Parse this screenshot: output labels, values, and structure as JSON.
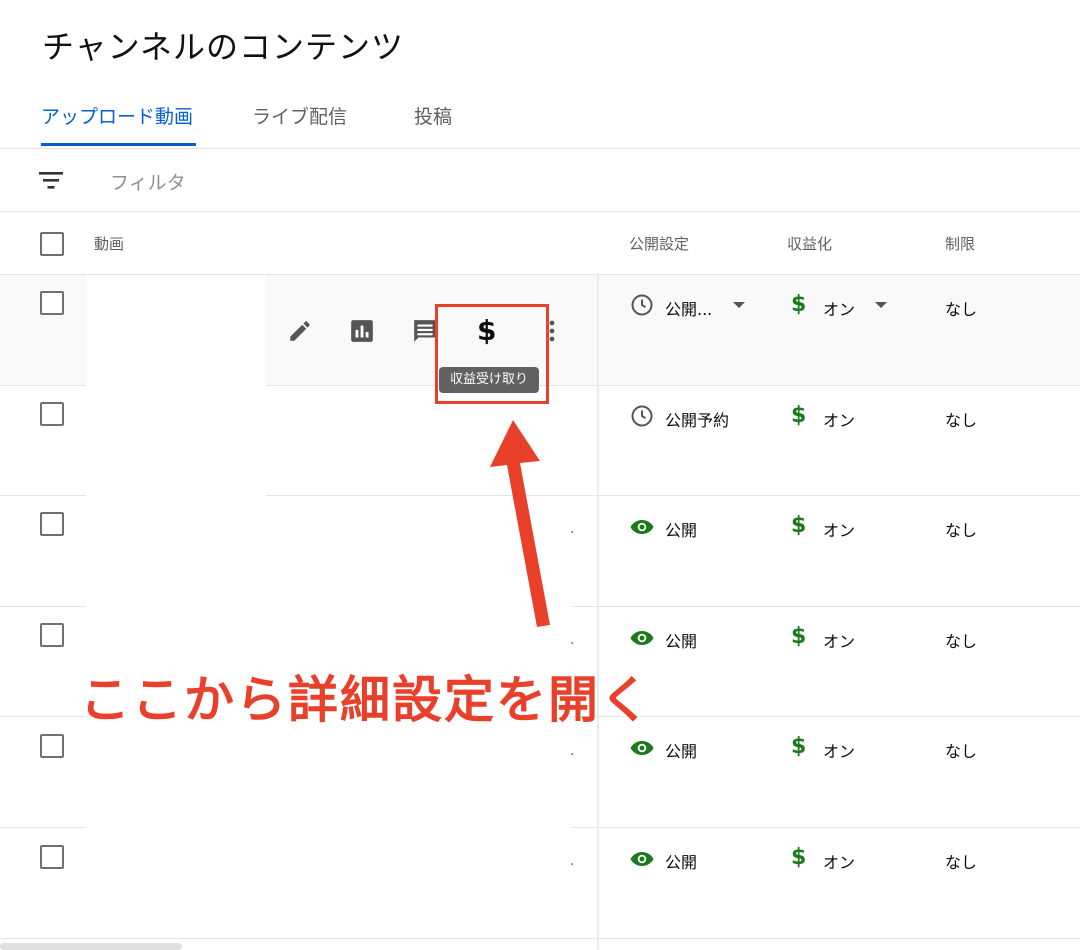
{
  "page": {
    "title": "チャンネルのコンテンツ"
  },
  "tabs": [
    {
      "label": "アップロード動画",
      "active": true
    },
    {
      "label": "ライブ配信",
      "active": false
    },
    {
      "label": "投稿",
      "active": false
    }
  ],
  "filter": {
    "placeholder": "フィルタ",
    "icon": "filter-icon"
  },
  "table": {
    "headers": {
      "video": "動画",
      "visibility": "公開設定",
      "monetization": "収益化",
      "restrictions": "制限"
    },
    "rows": [
      {
        "visibility": "公開...",
        "visibility_icon": "clock-icon",
        "monetization": "オン",
        "restrictions": "なし",
        "hovered": true
      },
      {
        "visibility": "公開予約",
        "visibility_icon": "clock-icon",
        "monetization": "オン",
        "restrictions": "なし"
      },
      {
        "visibility": "公開",
        "visibility_icon": "eye-icon",
        "monetization": "オン",
        "restrictions": "なし"
      },
      {
        "visibility": "公開",
        "visibility_icon": "eye-icon",
        "monetization": "オン",
        "restrictions": "なし"
      },
      {
        "visibility": "公開",
        "visibility_icon": "eye-icon",
        "monetization": "オン",
        "restrictions": "なし"
      },
      {
        "visibility": "公開",
        "visibility_icon": "eye-icon",
        "monetization": "オン",
        "restrictions": "なし"
      }
    ]
  },
  "row_actions": {
    "icons": [
      "pencil-icon",
      "analytics-icon",
      "comments-icon",
      "dollar-icon",
      "more-vert-icon"
    ],
    "dollar_symbol": "$",
    "tooltip": "収益受け取り"
  },
  "monetization_symbol": "$",
  "annotation": {
    "text": "ここから詳細設定を開く",
    "color": "#e8402a"
  },
  "colors": {
    "accent": "#065fd4",
    "monetize_green": "#1b7a1b",
    "eye_green": "#1b7a1b",
    "annotation_red": "#e8402a"
  }
}
